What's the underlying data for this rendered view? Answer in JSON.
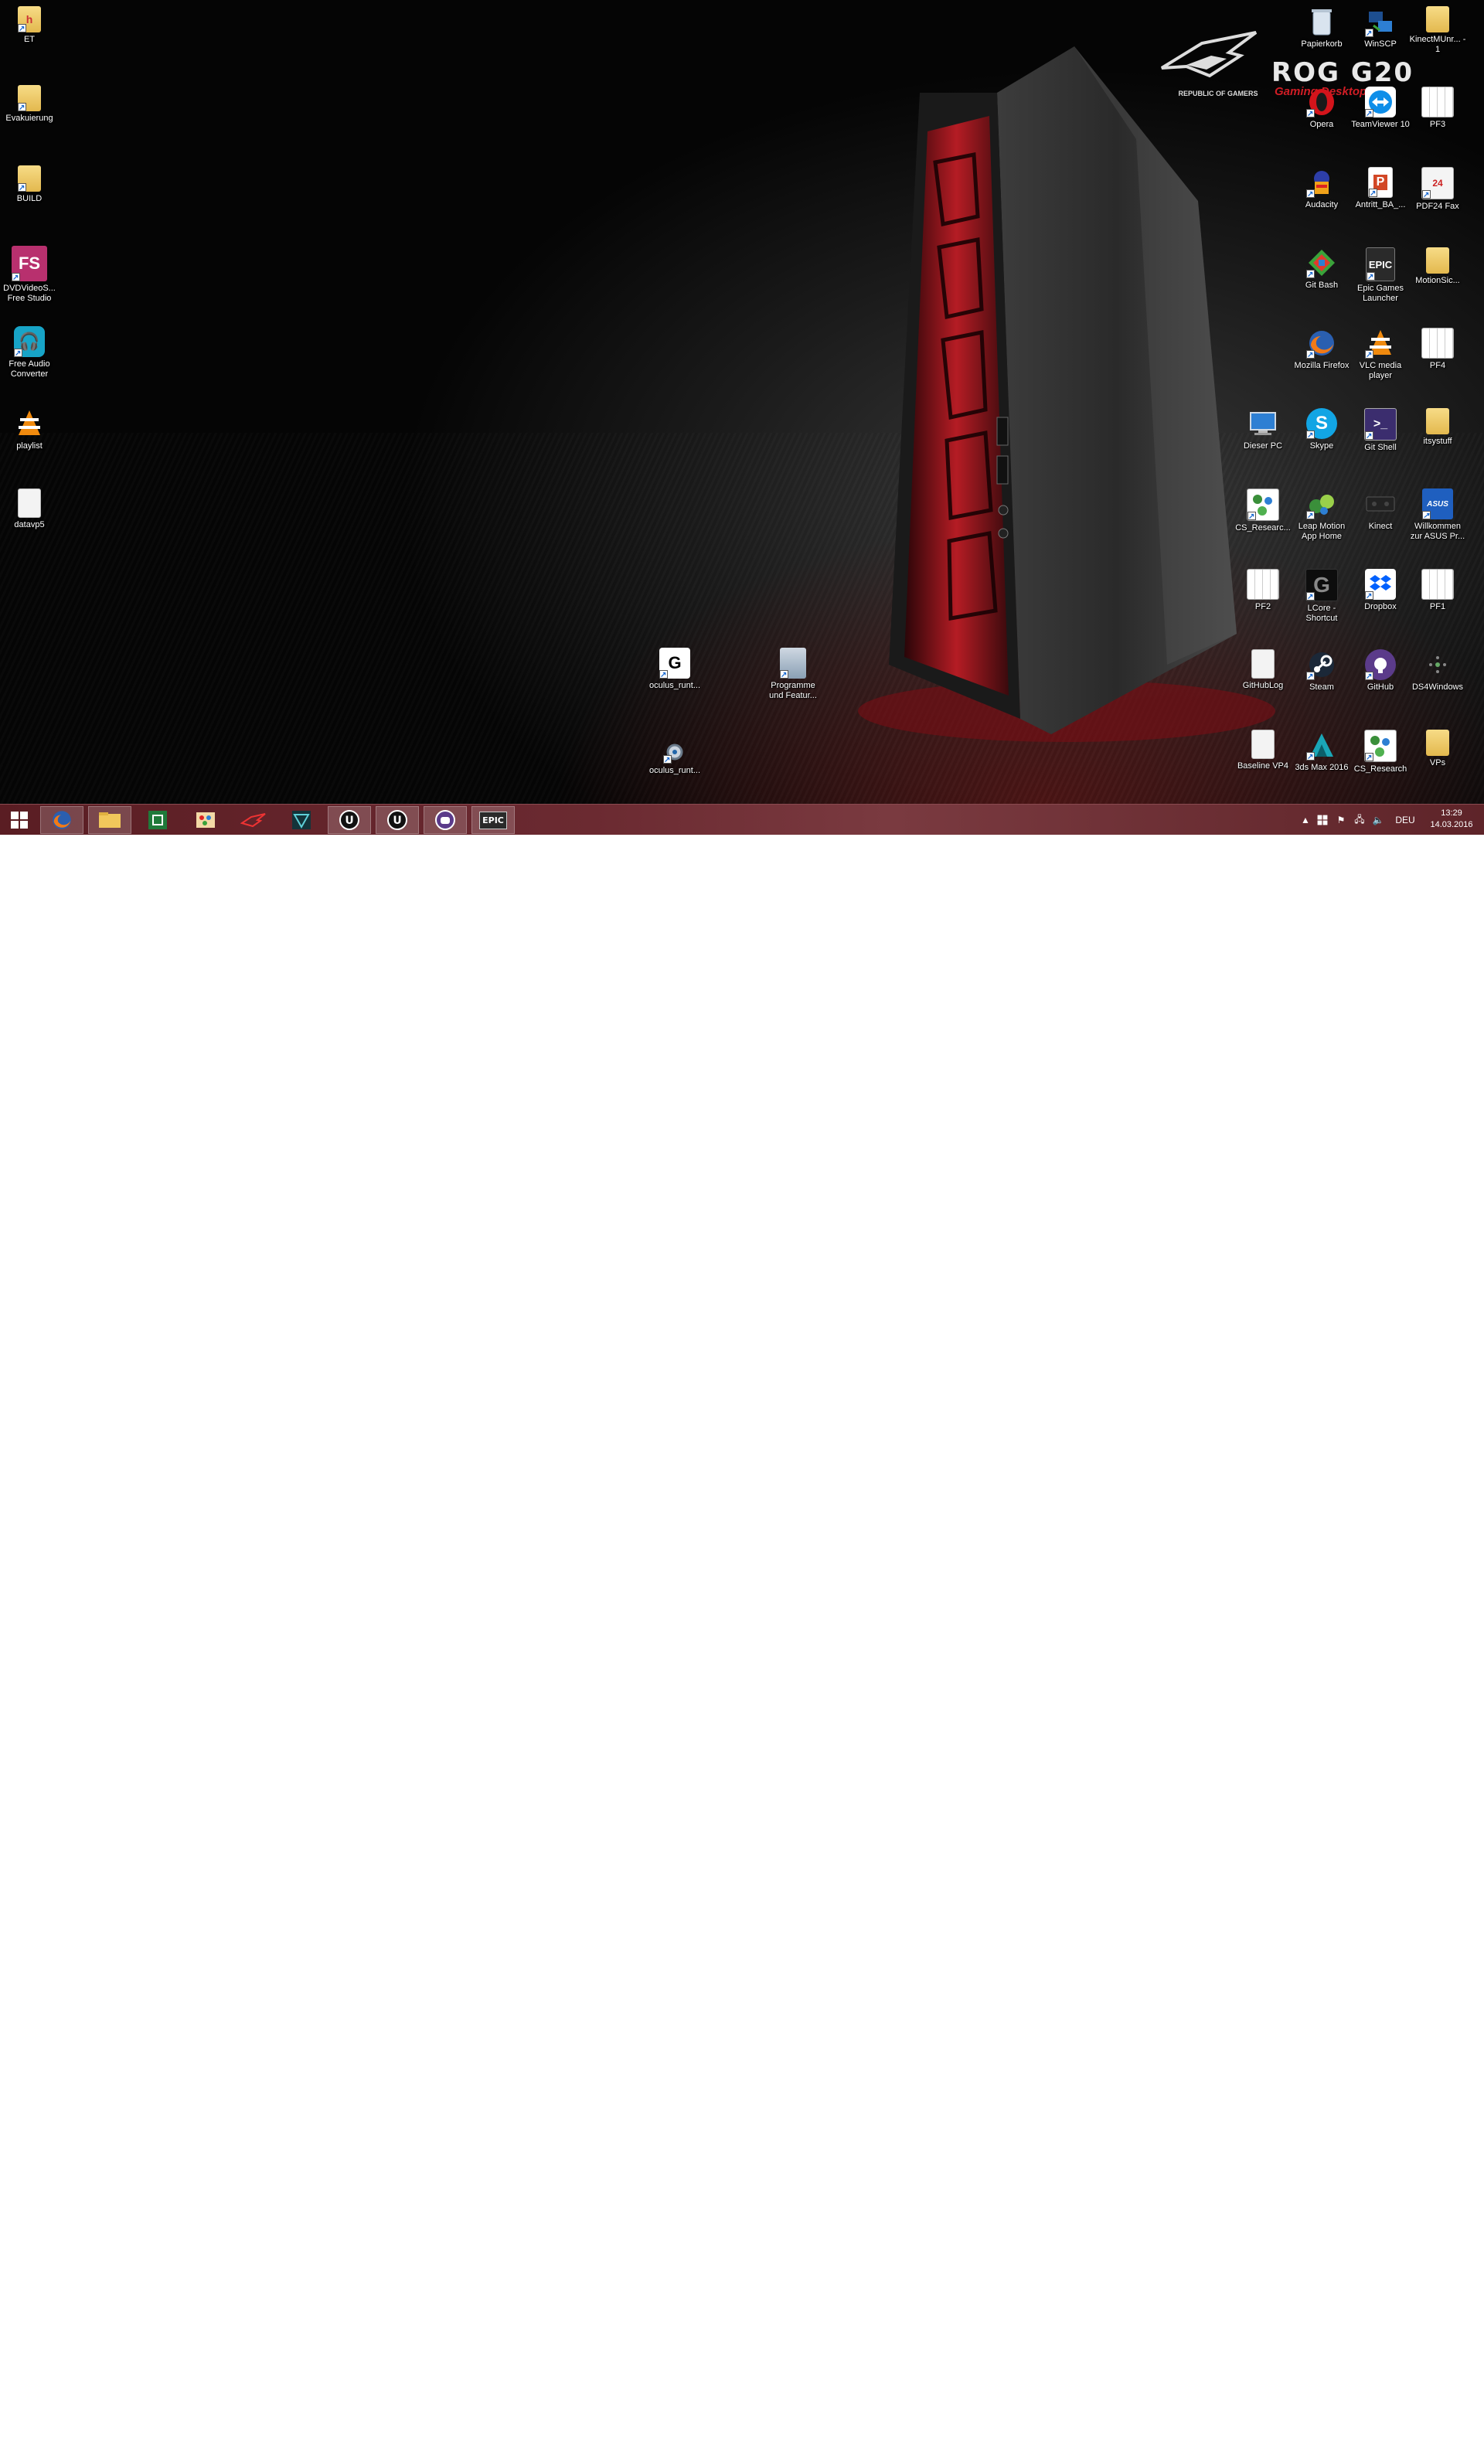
{
  "brand": {
    "logo": "ROG G20",
    "tagline": "Gaming Desktop",
    "caption": "REPUBLIC OF GAMERS"
  },
  "desktop_left": [
    {
      "label": "ET",
      "icon": "folder-icon"
    },
    {
      "label": "Evakuierung",
      "icon": "folder-icon"
    },
    {
      "label": "BUILD",
      "icon": "folder-icon"
    },
    {
      "label": "DVDVideoS... Free Studio",
      "icon": "fs-icon"
    },
    {
      "label": "Free Audio Converter",
      "icon": "headphones-icon"
    },
    {
      "label": "playlist",
      "icon": "vlc-icon"
    },
    {
      "label": "datavp5",
      "icon": "document-icon"
    }
  ],
  "desktop_middle": [
    {
      "label": "oculus_runt...",
      "icon": "oculus-icon"
    },
    {
      "label": "Programme und Featur...",
      "icon": "programs-icon"
    },
    {
      "label": "oculus_runt...",
      "icon": "installer-icon"
    }
  ],
  "desktop_right": {
    "col1": [
      {
        "label": "Dieser PC",
        "icon": "computer-icon"
      },
      {
        "label": "CS_Researc...",
        "icon": "cs-research-icon"
      },
      {
        "label": "PF2",
        "icon": "pages-icon"
      },
      {
        "label": "GitHubLog",
        "icon": "document-icon"
      },
      {
        "label": "Baseline VP4",
        "icon": "document-icon"
      }
    ],
    "col2": [
      {
        "label": "Papierkorb",
        "icon": "recycle-bin-icon"
      },
      {
        "label": "Opera",
        "icon": "opera-icon"
      },
      {
        "label": "Audacity",
        "icon": "audacity-icon"
      },
      {
        "label": "Git Bash",
        "icon": "git-bash-icon"
      },
      {
        "label": "Mozilla Firefox",
        "icon": "firefox-icon"
      },
      {
        "label": "Skype",
        "icon": "skype-icon"
      },
      {
        "label": "Leap Motion App Home",
        "icon": "leap-motion-icon"
      },
      {
        "label": "LCore - Shortcut",
        "icon": "lcore-icon"
      },
      {
        "label": "Steam",
        "icon": "steam-icon"
      },
      {
        "label": "3ds Max 2016",
        "icon": "3dsmax-icon"
      }
    ],
    "col3": [
      {
        "label": "WinSCP",
        "icon": "winscp-icon"
      },
      {
        "label": "TeamViewer 10",
        "icon": "teamviewer-icon"
      },
      {
        "label": "Antritt_BA_...",
        "icon": "powerpoint-icon"
      },
      {
        "label": "Epic Games Launcher",
        "icon": "epic-icon"
      },
      {
        "label": "VLC media player",
        "icon": "vlc-icon"
      },
      {
        "label": "Git Shell",
        "icon": "git-shell-icon"
      },
      {
        "label": "Kinect",
        "icon": "kinect-icon"
      },
      {
        "label": "Dropbox",
        "icon": "dropbox-icon"
      },
      {
        "label": "GitHub",
        "icon": "github-icon"
      },
      {
        "label": "CS_Research",
        "icon": "cs-research-icon"
      }
    ],
    "col4": [
      {
        "label": "KinectMUnr... - 1",
        "icon": "folder-icon"
      },
      {
        "label": "PF3",
        "icon": "pages-icon"
      },
      {
        "label": "PDF24 Fax",
        "icon": "pdf24-icon"
      },
      {
        "label": "MotionSic...",
        "icon": "folder-icon"
      },
      {
        "label": "PF4",
        "icon": "pages-icon"
      },
      {
        "label": "itsystuff",
        "icon": "folder-icon"
      },
      {
        "label": "Willkommen zur ASUS Pr...",
        "icon": "asus-icon"
      },
      {
        "label": "PF1",
        "icon": "pages-icon"
      },
      {
        "label": "DS4Windows",
        "icon": "ds4-icon"
      },
      {
        "label": "VPs",
        "icon": "folder-icon"
      }
    ]
  },
  "taskbar": {
    "apps": [
      "start-icon",
      "firefox-icon",
      "explorer-icon",
      "excel-icon",
      "paint-icon",
      "rog-icon",
      "sword-icon",
      "unreal-icon",
      "unreal-icon",
      "gamepad-icon",
      "epic-icon"
    ],
    "epic_label": "EPIC",
    "language": "DEU",
    "time": "13:29",
    "date": "14.03.2016"
  },
  "colors": {
    "taskbar": "#6b2a31",
    "accent_red": "#d01d25"
  }
}
